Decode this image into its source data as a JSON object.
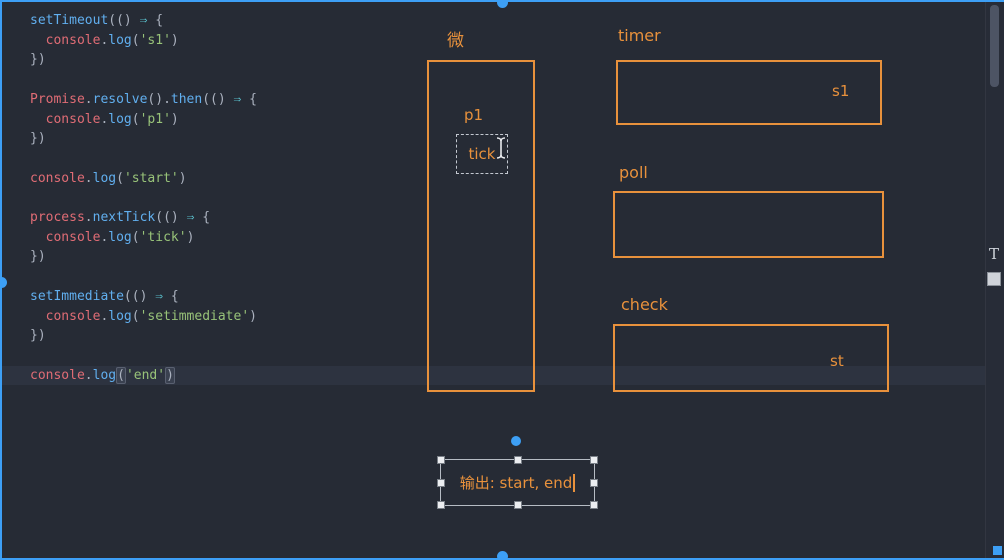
{
  "accent": {
    "selection_blue": "#3d9ff5",
    "draw_orange": "#e8913c"
  },
  "editor": {
    "token_colors": {
      "fn": "#61afef",
      "obj": "#e06c75",
      "str": "#98c379",
      "pun": "#abb2bf",
      "arrow": "#56b6c2",
      "brk": "#abb2bf"
    },
    "lines": [
      {
        "tokens": [
          [
            "setTimeout",
            "fn"
          ],
          [
            "(() ",
            "pun"
          ],
          [
            "⇒",
            "arrow"
          ],
          [
            " {",
            "pun"
          ]
        ]
      },
      {
        "tokens": [
          [
            "  ",
            "pun"
          ],
          [
            "console",
            "obj"
          ],
          [
            ".",
            "pun"
          ],
          [
            "log",
            "fn"
          ],
          [
            "(",
            "pun"
          ],
          [
            "'s1'",
            "str"
          ],
          [
            ")",
            "pun"
          ]
        ]
      },
      {
        "tokens": [
          [
            "})",
            "pun"
          ]
        ]
      },
      {
        "tokens": []
      },
      {
        "tokens": [
          [
            "Promise",
            "obj"
          ],
          [
            ".",
            "pun"
          ],
          [
            "resolve",
            "fn"
          ],
          [
            "().",
            "pun"
          ],
          [
            "then",
            "fn"
          ],
          [
            "(() ",
            "pun"
          ],
          [
            "⇒",
            "arrow"
          ],
          [
            " {",
            "pun"
          ]
        ]
      },
      {
        "tokens": [
          [
            "  ",
            "pun"
          ],
          [
            "console",
            "obj"
          ],
          [
            ".",
            "pun"
          ],
          [
            "log",
            "fn"
          ],
          [
            "(",
            "pun"
          ],
          [
            "'p1'",
            "str"
          ],
          [
            ")",
            "pun"
          ]
        ]
      },
      {
        "tokens": [
          [
            "})",
            "pun"
          ]
        ]
      },
      {
        "tokens": []
      },
      {
        "tokens": [
          [
            "console",
            "obj"
          ],
          [
            ".",
            "pun"
          ],
          [
            "log",
            "fn"
          ],
          [
            "(",
            "pun"
          ],
          [
            "'start'",
            "str"
          ],
          [
            ")",
            "pun"
          ]
        ]
      },
      {
        "tokens": []
      },
      {
        "tokens": [
          [
            "process",
            "obj"
          ],
          [
            ".",
            "pun"
          ],
          [
            "nextTick",
            "fn"
          ],
          [
            "(() ",
            "pun"
          ],
          [
            "⇒",
            "arrow"
          ],
          [
            " {",
            "pun"
          ]
        ]
      },
      {
        "tokens": [
          [
            "  ",
            "pun"
          ],
          [
            "console",
            "obj"
          ],
          [
            ".",
            "pun"
          ],
          [
            "log",
            "fn"
          ],
          [
            "(",
            "pun"
          ],
          [
            "'tick'",
            "str"
          ],
          [
            ")",
            "pun"
          ]
        ]
      },
      {
        "tokens": [
          [
            "})",
            "pun"
          ]
        ]
      },
      {
        "tokens": []
      },
      {
        "tokens": [
          [
            "setImmediate",
            "fn"
          ],
          [
            "(() ",
            "pun"
          ],
          [
            "⇒",
            "arrow"
          ],
          [
            " {",
            "pun"
          ]
        ]
      },
      {
        "tokens": [
          [
            "  ",
            "pun"
          ],
          [
            "console",
            "obj"
          ],
          [
            ".",
            "pun"
          ],
          [
            "log",
            "fn"
          ],
          [
            "(",
            "pun"
          ],
          [
            "'setimmediate'",
            "str"
          ],
          [
            ")",
            "pun"
          ]
        ]
      },
      {
        "tokens": [
          [
            "})",
            "pun"
          ]
        ]
      },
      {
        "tokens": []
      },
      {
        "tokens": [
          [
            "console",
            "obj"
          ],
          [
            ".",
            "pun"
          ],
          [
            "log",
            "fn"
          ],
          [
            "(",
            "brk"
          ],
          [
            "'end'",
            "str"
          ],
          [
            ")",
            "brk"
          ]
        ],
        "current": true
      }
    ]
  },
  "diagram": {
    "micro": {
      "label": "微",
      "items": [
        "p1",
        "tick"
      ]
    },
    "timer": {
      "label": "timer",
      "value": "s1"
    },
    "poll": {
      "label": "poll",
      "value": ""
    },
    "check": {
      "label": "check",
      "value": "st"
    },
    "output": {
      "text": "输出: start, end"
    }
  },
  "toolbar": {
    "text_tool": "T"
  }
}
